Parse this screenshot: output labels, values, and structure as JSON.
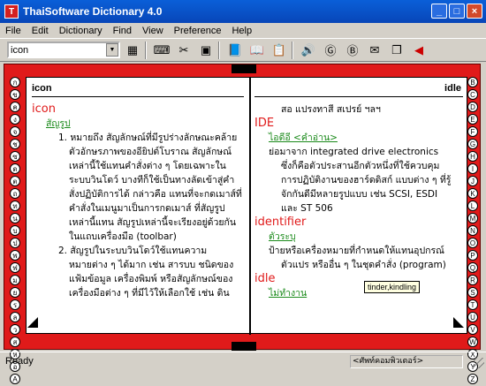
{
  "window": {
    "title": "ThaiSoftware Dictionary 4.0",
    "app_icon": "T"
  },
  "menu": [
    "File",
    "Edit",
    "Dictionary",
    "Find",
    "View",
    "Preference",
    "Help"
  ],
  "search": {
    "value": "icon"
  },
  "toolbar_icons": [
    "film-icon",
    "keyboard-icon",
    "scan-icon",
    "card-icon",
    "book-icon",
    "open-book-icon",
    "notepad-icon",
    "speaker-icon",
    "g-circle-icon",
    "b-circle-icon",
    "sign-icon",
    "copy-icon",
    "forward-icon"
  ],
  "left_page": {
    "header": "icon",
    "lines": [
      {
        "text": "icon",
        "cls": "hw"
      },
      {
        "text": "สัญรูป",
        "cls": "link ind1"
      },
      {
        "text": "1. หมายถึง สัญลักษณ์ที่มีรูปร่างลักษณะคล้าย",
        "cls": "ind2"
      },
      {
        "text": "ตัวอักษรภาพของอียิปต์โบราณ สัญลักษณ์",
        "cls": "ind3"
      },
      {
        "text": "เหล่านี้ใช้แทนคำสั่งต่าง ๆ โดยเฉพาะใน",
        "cls": "ind3"
      },
      {
        "text": "ระบบวินโดว์ บางทีก็ใช้เป็นทางลัดเข้าสู่คำ",
        "cls": "ind3"
      },
      {
        "text": "สั่งปฏิบัติการได้ กล่าวคือ แทนที่จะกดเมาส์ที่",
        "cls": "ind3"
      },
      {
        "text": "คำสั่งในเมนูมาเป็นการกดเมาส์ ที่สัญรูป",
        "cls": "ind3"
      },
      {
        "text": "เหล่านี้แทน สัญรูปเหล่านี้จะเรียงอยู่ด้วยกัน",
        "cls": "ind3"
      },
      {
        "text": "ในแถบเครื่องมือ (toolbar)",
        "cls": "ind3"
      },
      {
        "text": "2. สัญรูปในระบบวินโดว์ใช้แทนความ",
        "cls": "ind2"
      },
      {
        "text": "หมายต่าง ๆ ได้มาก เช่น สารบบ ชนิดของ",
        "cls": "ind3"
      },
      {
        "text": "แฟ้มข้อมูล เครื่องพิมพ์ หรือสัญลักษณ์ของ",
        "cls": "ind3"
      },
      {
        "text": "เครื่องมือต่าง ๆ ที่มีไว้ให้เลือกใช้ เช่น ดิน",
        "cls": "ind3"
      }
    ],
    "tabs": [
      "ก",
      "ข",
      "ค",
      "ง",
      "จ",
      "ช",
      "ซ",
      "ด",
      "ต",
      "ถ",
      "ท",
      "น",
      "บ",
      "ป",
      "พ",
      "ฟ",
      "ม",
      "ย",
      "ร",
      "ล",
      "ว",
      "ส",
      "ห",
      "อ",
      "A"
    ]
  },
  "right_page": {
    "header": "idle",
    "lines": [
      {
        "text": "สอ แปรงทาสี สเปรย์ ฯลฯ",
        "cls": "ind2"
      },
      {
        "text": "IDE",
        "cls": "hw"
      },
      {
        "text": "ไอดีอี <คำอ่าน>",
        "cls": "link ind1"
      },
      {
        "text": "ย่อมาจาก integrated drive electronics",
        "cls": "ind1"
      },
      {
        "text": "ซึ่งก็คือตัวประสานอีกตัวหนึ่งที่ใช้ควบคุม",
        "cls": "ind2"
      },
      {
        "text": "การปฏิบัติงานของฮาร์ดดิสก์ แบบต่าง ๆ ที่รู้",
        "cls": "ind2"
      },
      {
        "text": "จักกันดีมีหลายรูปแบบ เช่น SCSI, ESDI",
        "cls": "ind2"
      },
      {
        "text": "และ ST 506",
        "cls": "ind2"
      },
      {
        "text": "identifier",
        "cls": "hw"
      },
      {
        "text": "ตัวระบุ",
        "cls": "link ind1"
      },
      {
        "text": "ป้ายหรือเครื่องหมายที่กำหนดให้แทนอุปกรณ์",
        "cls": "ind1"
      },
      {
        "text": "ตัวแปร หรืออื่น ๆ ในชุดคำสั่ง (program)",
        "cls": "ind2"
      },
      {
        "text": "idle",
        "cls": "hw"
      },
      {
        "text": "ไม่ทำงาน",
        "cls": "link ind1"
      }
    ],
    "tabs": [
      "B",
      "C",
      "D",
      "E",
      "F",
      "G",
      "H",
      "I",
      "J",
      "K",
      "L",
      "M",
      "N",
      "O",
      "P",
      "Q",
      "R",
      "S",
      "T",
      "U",
      "V",
      "W",
      "X",
      "Y",
      "Z"
    ]
  },
  "tooltip": "tinder,kindling",
  "status": {
    "text": "Ready",
    "panel": "<ศัพท์คอมพิวเตอร์>"
  }
}
